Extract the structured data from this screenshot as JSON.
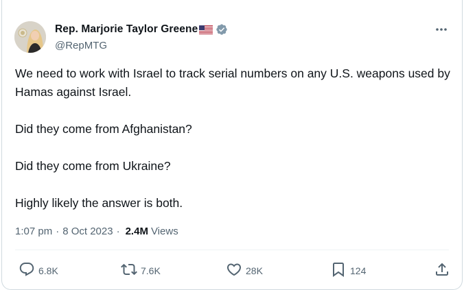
{
  "author": {
    "name": "Rep. Marjorie Taylor Greene",
    "handle": "@RepMTG"
  },
  "icons": {
    "flag": "us-flag-icon",
    "verified": "verified-badge-icon",
    "more": "more-options-icon",
    "reply": "reply-icon",
    "retweet": "retweet-icon",
    "like": "heart-icon",
    "bookmark": "bookmark-icon",
    "share": "share-icon"
  },
  "colors": {
    "verified": "#829aab",
    "text": "#0f1419",
    "secondary": "#536471"
  },
  "tweet": {
    "paragraphs": [
      "We need to work with Israel to track serial numbers on any U.S. weapons used by Hamas against Israel.",
      "Did they come from Afghanistan?",
      "Did they come from Ukraine?",
      "Highly likely the answer is both."
    ],
    "time": "1:07 pm",
    "separator": "·",
    "date": "8 Oct 2023",
    "views_count": "2.4M",
    "views_label": "Views"
  },
  "actions": {
    "replies": "6.8K",
    "reposts": "7.6K",
    "likes": "28K",
    "bookmarks": "124"
  }
}
